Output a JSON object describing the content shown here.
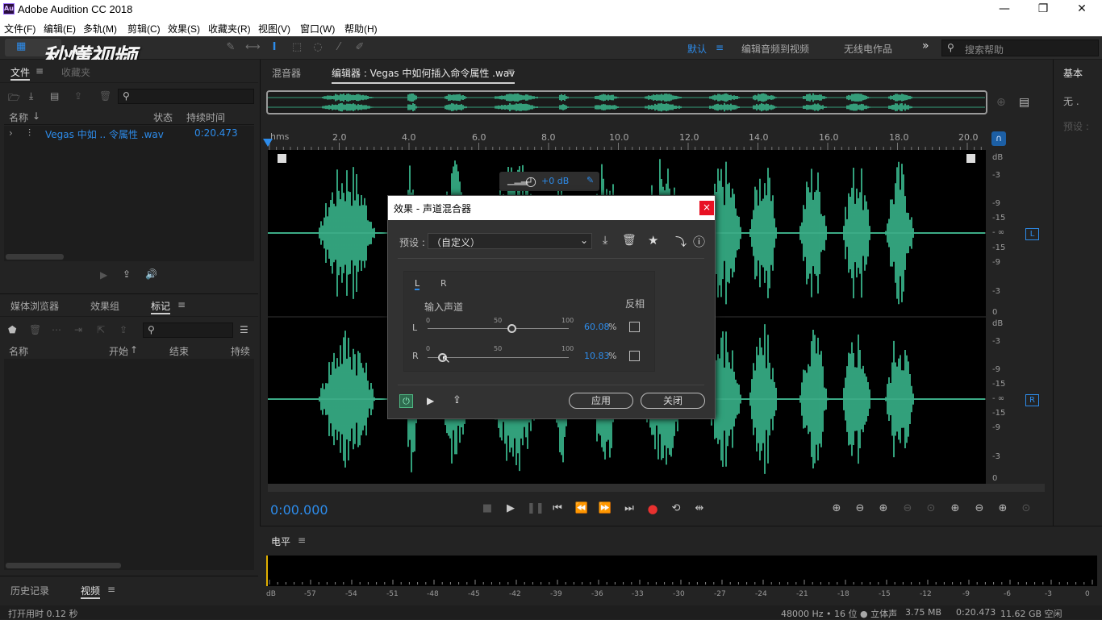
{
  "window": {
    "title": "Adobe Audition CC 2018",
    "app_icon": "Au",
    "minimize": "—",
    "restore": "❐",
    "close": "✕"
  },
  "menu": [
    "文件(F)",
    "编辑(E)",
    "多轨(M)",
    "剪辑(C)",
    "效果(S)",
    "收藏夹(R)",
    "视图(V)",
    "窗口(W)",
    "帮助(H)"
  ],
  "watermark": "秒懂视频",
  "toolbar": {
    "workspace_default": "默认",
    "workspace_edit_video": "编辑音频到视频",
    "workspace_radio": "无线电作品",
    "more": "»",
    "search_placeholder": "搜索帮助"
  },
  "files_panel": {
    "tab_files": "文件",
    "tab_favorites": "收藏夹",
    "col_name": "名称",
    "col_status": "状态",
    "col_duration": "持续时间",
    "file_name": "Vegas 中如 .. 令属性 .wav",
    "file_duration": "0:20.473"
  },
  "markers_panel": {
    "tab_media": "媒体浏览器",
    "tab_effects": "效果组",
    "tab_markers": "标记",
    "col_name": "名称",
    "col_start": "开始",
    "col_end": "结束",
    "col_duration": "持续时"
  },
  "history_panel": {
    "tab_history": "历史记录",
    "tab_video": "视频"
  },
  "editor": {
    "tab_mixer": "混音器",
    "tab_editor": "编辑器 : Vegas 中如何插入命令属性 .wav",
    "ruler_unit": "hms",
    "ruler_ticks": [
      "2.0",
      "4.0",
      "6.0",
      "8.0",
      "10.0",
      "12.0",
      "14.0",
      "16.0",
      "18.0",
      "20.0"
    ],
    "hud_gain": "+0 dB",
    "db_scale_top": [
      "dB",
      "-3",
      "-9",
      "-15",
      "- ∞",
      "-15",
      "-9",
      "-3",
      "0"
    ],
    "db_scale_bottom": [
      "dB",
      "-3",
      "-9",
      "-15",
      "- ∞",
      "-15",
      "-9",
      "-3",
      "0"
    ],
    "channel_L": "L",
    "channel_R": "R",
    "time_display": "0:00.000"
  },
  "right_panel": {
    "title": "基本",
    "item": "无 .",
    "preset": "预设 :"
  },
  "dialog": {
    "title": "效果 - 声道混合器",
    "close": "×",
    "preset_label": "预设 :",
    "preset_value": "（自定义）",
    "tab_L": "L",
    "tab_R": "R",
    "input_channel": "输入声道",
    "invert": "反相",
    "row_L": {
      "label": "L",
      "scale_0": "0",
      "scale_50": "50",
      "scale_100": "100",
      "value": "60.08",
      "unit": "%",
      "fraction": 0.6008
    },
    "row_R": {
      "label": "R",
      "scale_0": "0",
      "scale_50": "50",
      "scale_100": "100",
      "value": "10.83",
      "unit": "%",
      "fraction": 0.1083
    },
    "apply": "应用",
    "close_btn": "关闭"
  },
  "levels": {
    "title": "电平",
    "scale": [
      "dB",
      "-57",
      "-54",
      "-51",
      "-48",
      "-45",
      "-42",
      "-39",
      "-36",
      "-33",
      "-30",
      "-27",
      "-24",
      "-21",
      "-18",
      "-15",
      "-12",
      "-9",
      "-6",
      "-3",
      "0"
    ]
  },
  "status": {
    "left": "打开用时 0.12 秒",
    "format": "48000 Hz • 16 位 ● 立体声",
    "size": "3.75 MB",
    "duration": "0:20.473",
    "free": "11.62 GB 空闲"
  },
  "colors": {
    "waveform": "#3ec99a",
    "accent": "#2d8ceb",
    "record": "#e8312f",
    "bg": "#232323"
  }
}
